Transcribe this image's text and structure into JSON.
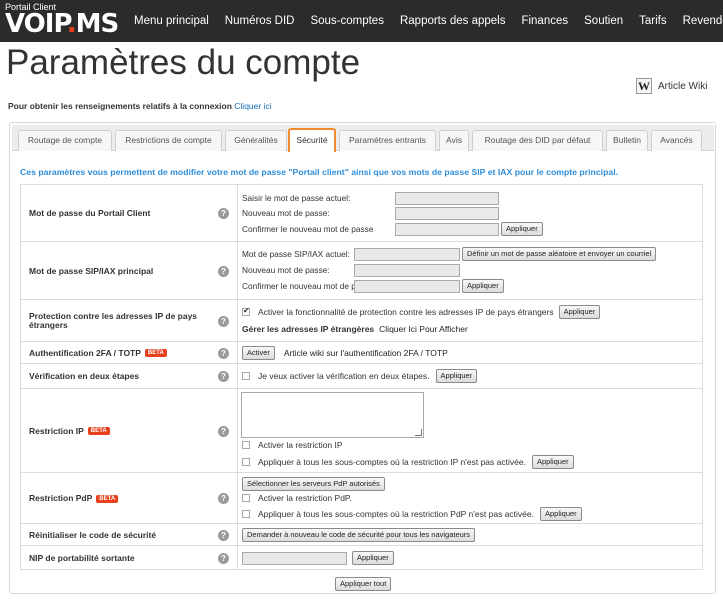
{
  "header": {
    "portal_label": "Portail Client",
    "logo_text": "VOIP",
    "logo_dot": ".",
    "logo_suffix": "MS",
    "nav": [
      "Menu principal",
      "Numéros DID",
      "Sous-comptes",
      "Rapports des appels",
      "Finances",
      "Soutien",
      "Tarifs",
      "Revendeur"
    ]
  },
  "page": {
    "title": "Paramètres du compte",
    "wiki_icon": "W",
    "wiki_label": "Article Wiki",
    "login_info": "Pour obtenir les renseignements relatifs à la connexion",
    "login_link": "Cliquer ici"
  },
  "tabs": [
    {
      "label": "Routage de compte",
      "active": false
    },
    {
      "label": "Restrictions de compte",
      "active": false
    },
    {
      "label": "Généralités",
      "active": false
    },
    {
      "label": "Sécurité",
      "active": true
    },
    {
      "label": "Paramètres entrants",
      "active": false
    },
    {
      "label": "Avis",
      "active": false
    },
    {
      "label": "Routage des DID par défaut",
      "active": false
    },
    {
      "label": "Bulletin",
      "active": false
    },
    {
      "label": "Avancés",
      "active": false
    }
  ],
  "description": "Ces paramètres vous permettent de modifier votre mot de passe \"Portail client\" ainsi que vos mots de passe SIP et IAX pour le compte principal.",
  "help_glyph": "?",
  "beta_label": "BETA",
  "sections": {
    "portal_password": {
      "label": "Mot de passe du Portail Client",
      "current": "Saisir le mot de passe actuel:",
      "new": "Nouveau mot de passe:",
      "confirm": "Confirmer le nouveau mot de passe",
      "apply": "Appliquer"
    },
    "sip_password": {
      "label": "Mot de passe SIP/IAX principal",
      "current": "Mot de passe SIP/IAX actuel:",
      "generate": "Définir un mot de passe aléatoire et envoyer un courriel",
      "new": "Nouveau mot de passe:",
      "confirm": "Confirmer le nouveau mot de passe:",
      "apply": "Appliquer"
    },
    "ip_protection": {
      "label": "Protection contre les adresses IP de pays étrangers",
      "checkbox": "Activer la fonctionnalité de protection contre les adresses IP de pays étrangers",
      "checked": true,
      "apply": "Appliquer",
      "manage_label": "Gérer les adresses IP étrangères",
      "manage_link": "Cliquer Ici Pour Afficher"
    },
    "twofa": {
      "label": "Authentification 2FA / TOTP",
      "activate": "Activer",
      "wiki": "Article wiki sur l'authentification 2FA / TOTP"
    },
    "two_step": {
      "label": "Vérification en deux étapes",
      "checkbox": "Je veux activer la vérification en deux étapes.",
      "apply": "Appliquer"
    },
    "ip_restriction": {
      "label": "Restriction IP",
      "enable": "Activer la restriction IP",
      "apply_all_sub": "Appliquer à tous les sous-comptes où la restriction IP n'est pas activée.",
      "apply": "Appliquer"
    },
    "pdp_restriction": {
      "label": "Restriction PdP",
      "select_servers": "Sélectionner les serveurs PdP autorisés",
      "enable": "Activer la restriction PdP.",
      "apply_all_sub": "Appliquer à tous les sous-comptes où la restriction PdP n'est pas activée.",
      "apply": "Appliquer"
    },
    "reset_code": {
      "label": "Réinitialiser le code de sécurité",
      "button": "Demander à nouveau le code de sécurité pour tous les navigateurs"
    },
    "pin": {
      "label": "NIP de portabilité sortante",
      "apply": "Appliquer"
    }
  },
  "apply_all": "Appliquer tout"
}
